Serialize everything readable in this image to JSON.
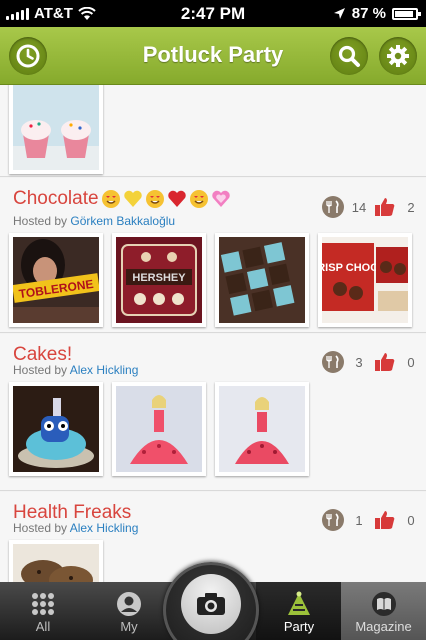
{
  "status_bar": {
    "carrier": "AT&T",
    "time": "2:47 PM",
    "battery": "87 %"
  },
  "nav": {
    "title": "Potluck Party",
    "left_icon": "clock-icon",
    "right_icons": [
      "search-icon",
      "gear-icon"
    ]
  },
  "parties": [
    {
      "title": "Chocolate",
      "emojis": [
        "grinning-heart-eyes",
        "yellow-heart",
        "grinning-heart-eyes",
        "red-heart",
        "grinning-heart-eyes",
        "pink-sparkle-heart"
      ],
      "hosted_by_label": "Hosted by",
      "host": "Görkem Bakkaloğlu",
      "forks": "14",
      "likes": "2"
    },
    {
      "title": "Cakes!",
      "hosted_by_label": "Hosted by",
      "host": "Alex Hickling",
      "forks": "3",
      "likes": "0"
    },
    {
      "title": "Health Freaks",
      "hosted_by_label": "Hosted by",
      "host": "Alex Hickling",
      "forks": "1",
      "likes": "0"
    }
  ],
  "photo_text": {
    "toblerone": "TOBLERONE",
    "hershey": "HERSHEY",
    "crisp_choco": "CRISP CHOCO"
  },
  "tabs": [
    {
      "label": "All",
      "icon": "grid-icon"
    },
    {
      "label": "My",
      "icon": "person-icon"
    },
    {
      "label": "Party",
      "icon": "party-icon"
    },
    {
      "label": "Magazine",
      "icon": "book-icon"
    }
  ],
  "colors": {
    "accent_green": "#94b83a",
    "title_red": "#d8453e",
    "link_blue": "#2a7fc0"
  }
}
